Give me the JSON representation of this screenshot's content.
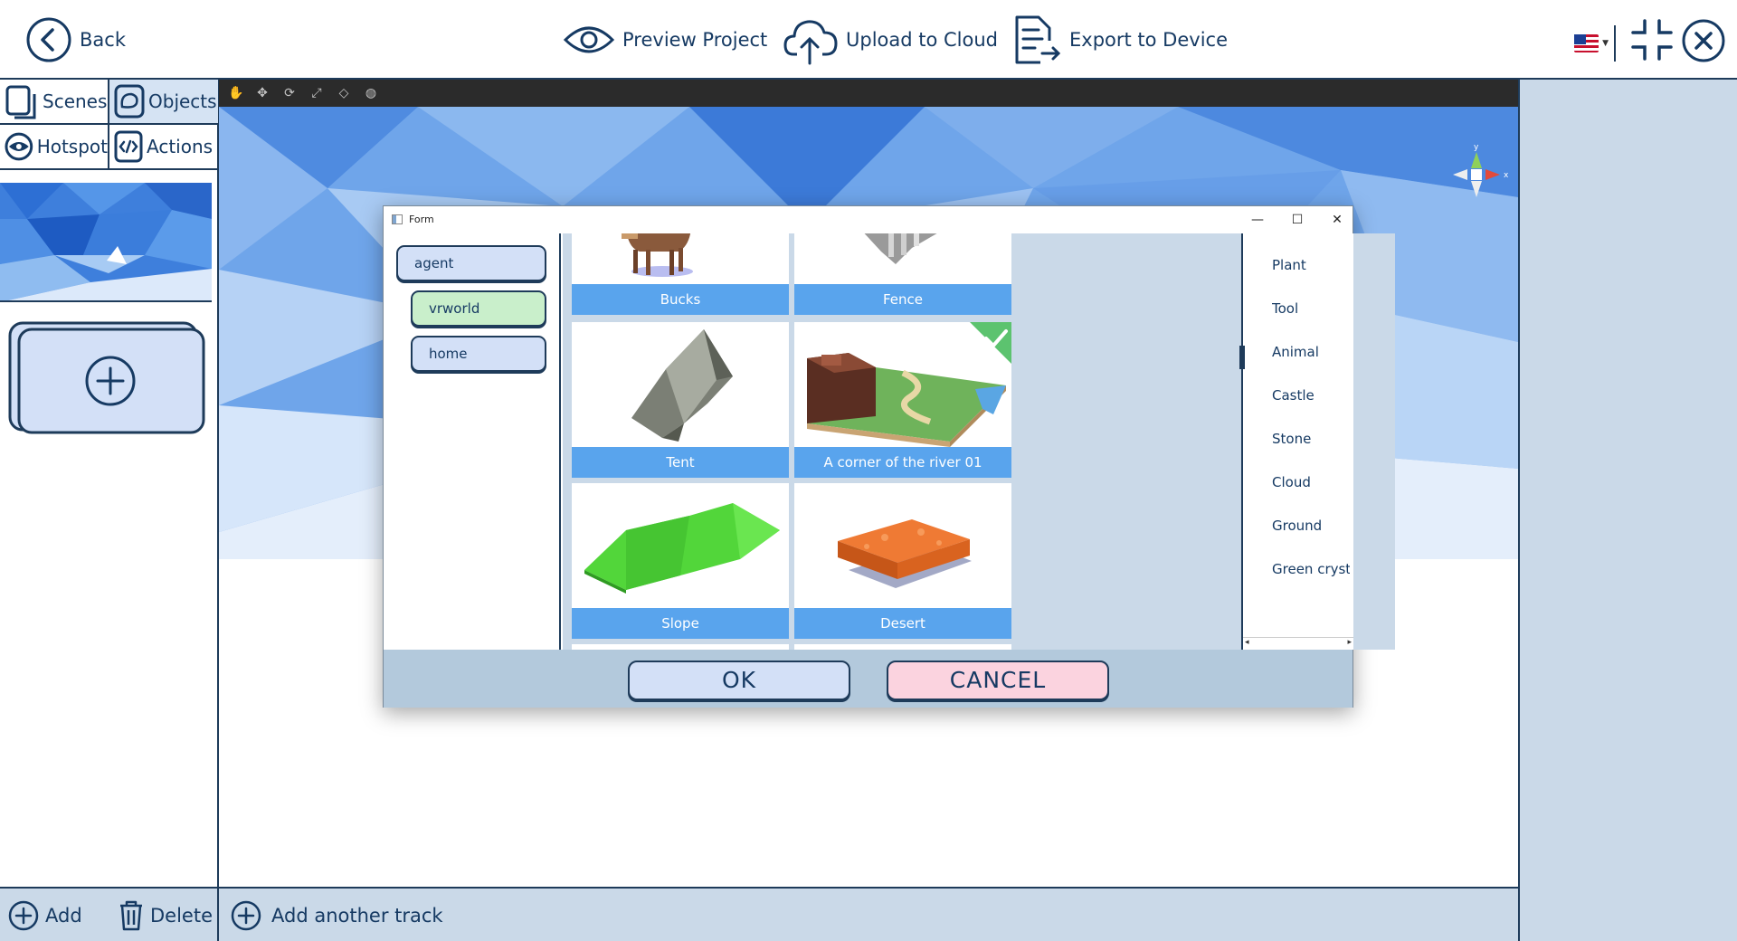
{
  "topbar": {
    "back_label": "Back",
    "preview_label": "Preview Project",
    "upload_label": "Upload to Cloud",
    "export_label": "Export to Device",
    "language_icon": "us-flag-icon"
  },
  "left_panel": {
    "tabs": [
      {
        "label": "Scenes",
        "icon": "scenes-icon"
      },
      {
        "label": "Objects",
        "icon": "objects-icon"
      },
      {
        "label": "Hotspot",
        "icon": "eye-icon"
      },
      {
        "label": "Actions",
        "icon": "code-icon"
      }
    ],
    "active_tab": "Objects",
    "bottom": {
      "add_label": "Add",
      "delete_label": "Delete"
    }
  },
  "viewport": {
    "toolbar_tools": [
      "hand-icon",
      "move-icon",
      "rotate-icon",
      "scale-icon",
      "view-icon",
      "globe-icon"
    ],
    "gizmo_axes": [
      "y",
      "x"
    ],
    "add_track_label": "Add another track"
  },
  "dialog": {
    "title": "Form",
    "tree": [
      {
        "label": "agent"
      },
      {
        "label": "vrworld"
      },
      {
        "label": "home"
      }
    ],
    "selected_node": "vrworld",
    "assets": [
      {
        "name": "Bucks"
      },
      {
        "name": "Fence"
      },
      {
        "name": "Tent"
      },
      {
        "name": "A corner of the river 01",
        "selected": true
      },
      {
        "name": "Slope"
      },
      {
        "name": "Desert"
      }
    ],
    "categories": [
      "Plant",
      "Tool",
      "Animal",
      "Castle",
      "Stone",
      "Cloud",
      "Ground",
      "Green crysta"
    ],
    "ok_label": "OK",
    "cancel_label": "CANCEL"
  },
  "colors": {
    "accent_blue": "#59a4ed",
    "navy": "#1e3b5a",
    "panel_gray_blue": "#cad9e8",
    "ok_fill": "#d3e0f7",
    "cancel_fill": "#fbd3df",
    "selected_green": "#c9efcb",
    "check_green": "#5cc36f"
  }
}
